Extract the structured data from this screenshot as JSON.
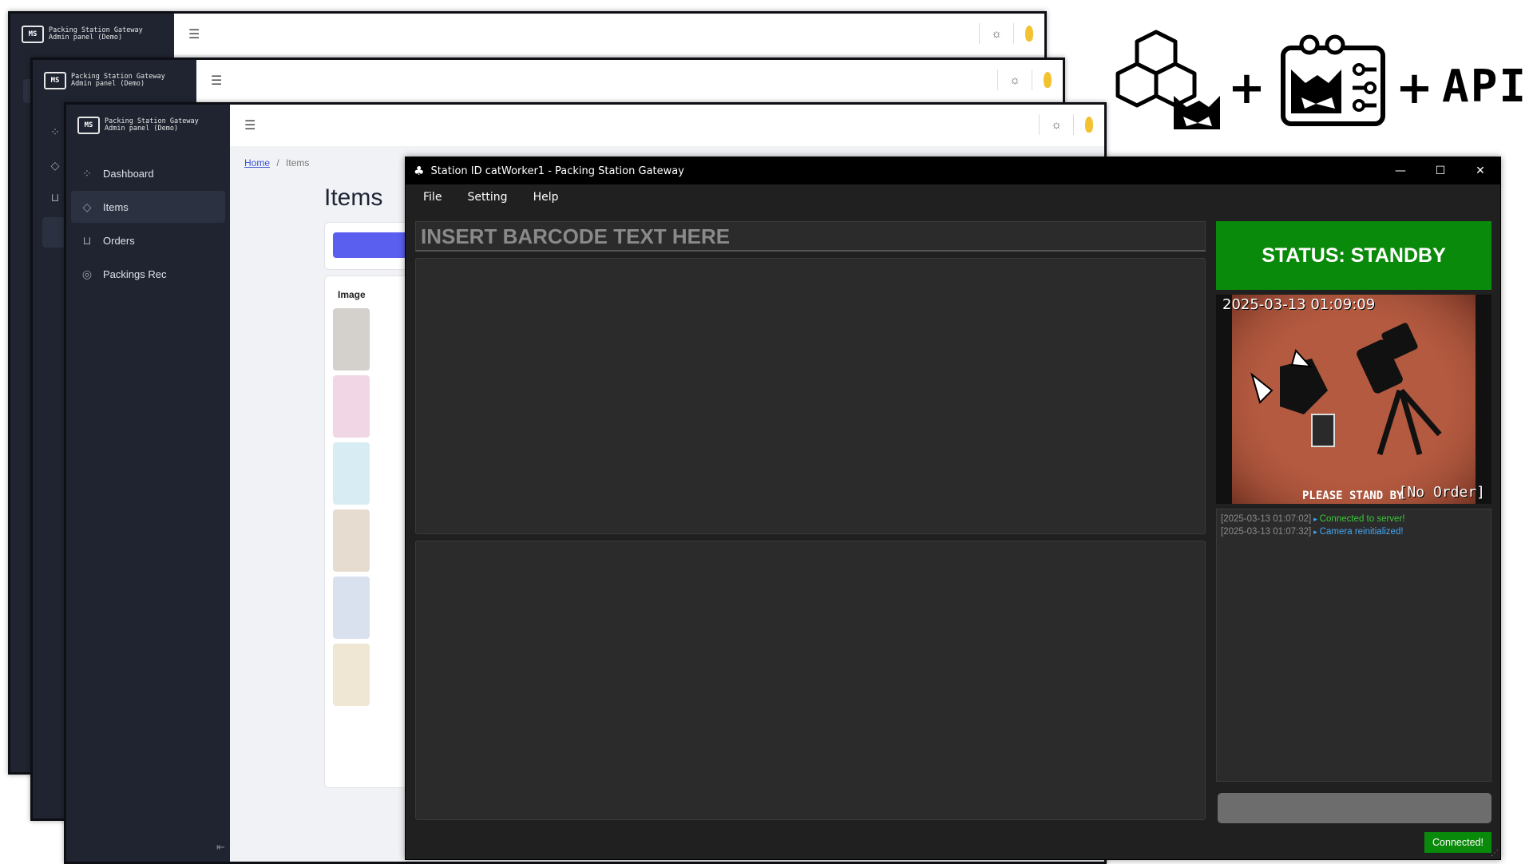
{
  "admin_panel": {
    "brand_line1": "Packing Station Gateway",
    "brand_line2": "Admin panel (Demo)",
    "logo_text": "MS",
    "menu_icon": "hamburger-icon",
    "nav": [
      {
        "label": "Dashboard",
        "icon": "grid-icon"
      },
      {
        "label": "Items",
        "icon": "gem-icon"
      },
      {
        "label": "Orders",
        "icon": "cart-icon"
      },
      {
        "label": "Packings Rec",
        "icon": "camera-icon"
      }
    ],
    "breadcrumb_home": "Home",
    "breadcrumb_sep": "/",
    "breadcrumb_current": "Items",
    "page_title": "Items",
    "table_header_image": "Image"
  },
  "header_graphic": {
    "plus1": "+",
    "plus2": "+",
    "api": "API"
  },
  "gateway": {
    "title": "Station ID catWorker1 - Packing Station Gateway",
    "menu": [
      "File",
      "Setting",
      "Help"
    ],
    "barcode_placeholder": "INSERT BARCODE TEXT HERE",
    "status": "STATUS: STANDBY",
    "status_color": "#0a8a0a",
    "camera": {
      "timestamp": "2025-03-13 01:09:09",
      "order": "[No Order]",
      "stand_by_text": "PLEASE STAND BY"
    },
    "log": [
      {
        "time": "[2025-03-13 01:07:02]",
        "message": "Connected to server!",
        "color": "#38c938"
      },
      {
        "time": "[2025-03-13 01:07:32]",
        "message": "Camera reinitialized!",
        "color": "#45a7f2"
      }
    ],
    "connection_status": "Connected!"
  }
}
